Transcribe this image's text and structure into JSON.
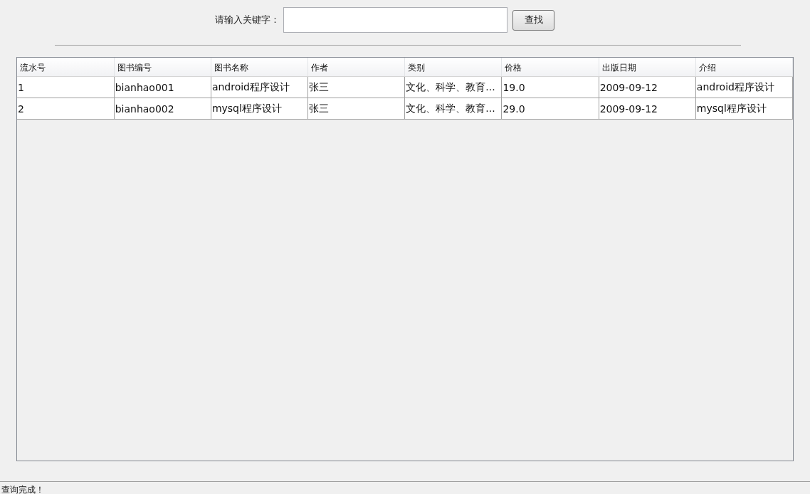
{
  "search": {
    "label": "请输入关键字：",
    "button": "查找"
  },
  "table": {
    "columns": [
      "流水号",
      "图书编号",
      "图书名称",
      "作者",
      "类别",
      "价格",
      "出版日期",
      "介绍"
    ],
    "rows": [
      [
        "1",
        "bianhao001",
        "android程序设计",
        "张三",
        "文化、科学、教育...",
        "19.0",
        "2009-09-12",
        "android程序设计"
      ],
      [
        "2",
        "bianhao002",
        "mysql程序设计",
        "张三",
        "文化、科学、教育...",
        "29.0",
        "2009-09-12",
        "mysql程序设计"
      ]
    ]
  },
  "status_bar": "查询完成！"
}
